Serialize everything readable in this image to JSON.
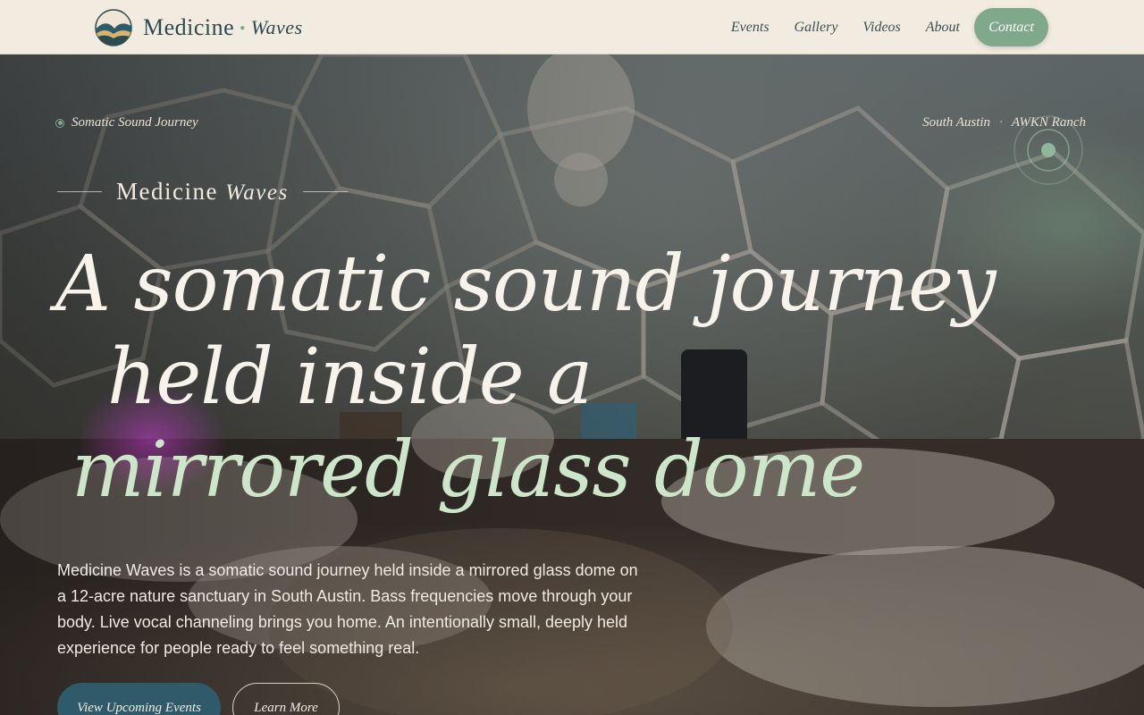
{
  "brand": {
    "name_main": "Medicine",
    "name_script": "Waves"
  },
  "nav": {
    "links": [
      {
        "label": "Events"
      },
      {
        "label": "Gallery"
      },
      {
        "label": "Videos"
      },
      {
        "label": "About"
      }
    ],
    "contact_label": "Contact"
  },
  "hero": {
    "eyebrow": "Somatic Sound Journey",
    "location_area": "South Austin",
    "location_separator": "·",
    "location_venue": "AWKN Ranch",
    "brand_main": "Medicine",
    "brand_script": "Waves",
    "headline_line1": "A somatic sound journey",
    "headline_line2": "held inside a",
    "headline_line3": "mirrored glass dome",
    "lede": "Medicine Waves is a somatic sound journey held inside a mirrored glass dome on a 12-acre nature sanctuary in South Austin. Bass frequencies move through your body. Live vocal channeling brings you home. An intentionally small, deeply held experience for people ready to feel something real.",
    "primary_cta": "View Upcoming Events",
    "secondary_cta": "Learn More"
  },
  "colors": {
    "nav_bg": "#f2ebe0",
    "sage_accent": "#7fa98a",
    "deep_teal": "#2f5a6a",
    "headline_accent": "#cde6c9"
  },
  "icons": {
    "logo": "wave-emblem-icon",
    "eyebrow_marker": "ring-dot-icon",
    "pulse": "pulse-ring-icon"
  }
}
